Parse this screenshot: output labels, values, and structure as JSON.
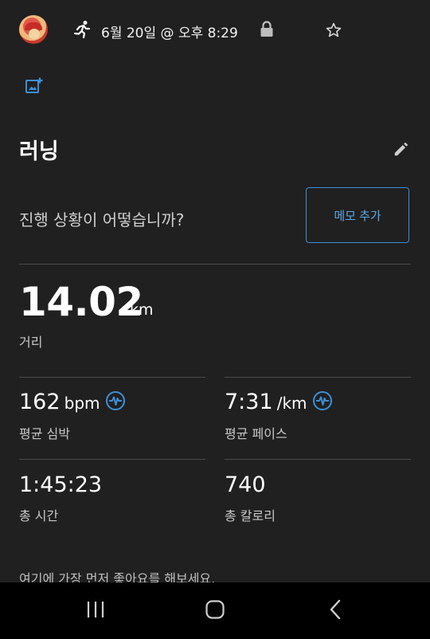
{
  "header": {
    "date_time": "6월 20일 @ 오후 8:29",
    "activity_icon": "running-icon",
    "lock_icon": "lock-icon",
    "favorite_icon": "star-outline-icon",
    "add_photo_icon": "add-photo-icon"
  },
  "activity": {
    "title": "러닝",
    "edit_icon": "pencil-icon"
  },
  "note": {
    "prompt": "진행 상황이 어떻습니까?",
    "button_label": "메모 추가"
  },
  "distance": {
    "value": "14.02",
    "unit": "km",
    "label": "거리"
  },
  "stats": {
    "heart_rate": {
      "value": "162",
      "unit": "bpm",
      "label": "평균 심박",
      "icon": "heart-rate-icon"
    },
    "pace": {
      "value": "7:31",
      "unit": "/km",
      "label": "평균 페이스",
      "icon": "heart-rate-icon"
    },
    "time": {
      "value": "1:45:23",
      "label": "총 시간"
    },
    "calories": {
      "value": "740",
      "label": "총 칼로리"
    }
  },
  "footer": {
    "like_prompt": "여기에 가장 먼저 좋아요를 해보세요."
  },
  "navbar": {
    "recents_icon": "recents-icon",
    "home_icon": "home-icon",
    "back_icon": "back-icon"
  },
  "colors": {
    "background": "#202020",
    "accent": "#3d8fd6",
    "navbar": "#000000"
  }
}
